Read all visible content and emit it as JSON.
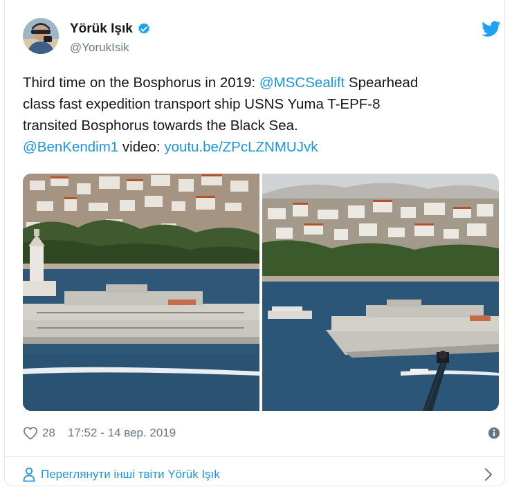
{
  "author": {
    "display_name": "Yörük Işık",
    "handle": "@YorukIsik",
    "verified": true
  },
  "tweet": {
    "lines": [
      [
        {
          "text": "Third time on the Bosphorus in 2019: ",
          "link": false
        },
        {
          "text": "@MSCSealift",
          "link": true
        },
        {
          "text": " Spearhead",
          "link": false
        }
      ],
      [
        {
          "text": "class fast expedition transport ship USNS Yuma T-EPF-8",
          "link": false
        }
      ],
      [
        {
          "text": "transited Bosphorus towards the Black Sea.",
          "link": false
        }
      ],
      [
        {
          "text": "@BenKendim1",
          "link": true
        },
        {
          "text": " video: ",
          "link": false
        },
        {
          "text": "youtu.be/ZPcLZNMUJvk",
          "link": true
        }
      ]
    ]
  },
  "media": {
    "photos": [
      {
        "name": "ship-photo-left",
        "subject": "USNS Yuma on the Bosphorus with Maiden's Tower"
      },
      {
        "name": "ship-photo-right",
        "subject": "USNS Yuma transiting towards the Black Sea"
      }
    ]
  },
  "meta": {
    "like_count": "28",
    "timestamp": "17:52 - 14 вер. 2019"
  },
  "more_tweets": {
    "label": "Переглянути інші твіти Yörük Işık"
  },
  "icons": {
    "bird": "twitter-bird-icon",
    "verified": "verified-badge-icon",
    "like": "heart-icon",
    "info": "info-icon",
    "profile": "person-icon",
    "chevron": "chevron-right-icon"
  },
  "colors": {
    "link": "#1b95e0",
    "text": "#14171a",
    "secondary": "#657786",
    "border": "#e1e8ed"
  }
}
